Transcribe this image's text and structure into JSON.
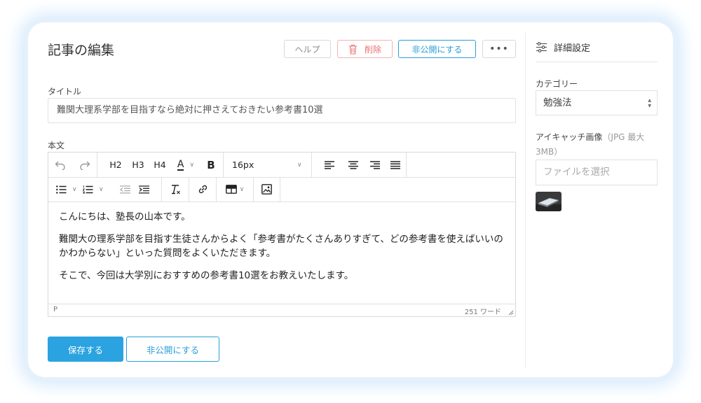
{
  "header": {
    "title": "記事の編集",
    "help_label": "ヘルプ",
    "delete_label": "削除",
    "unpublish_label": "非公開にする",
    "more_label": "•••"
  },
  "form": {
    "title_label": "タイトル",
    "title_value": "難関大理系学部を目指すなら絶対に押さえておきたい参考書10選",
    "body_label": "本文"
  },
  "toolbar": {
    "headings": [
      "H2",
      "H3",
      "H4"
    ],
    "text_color_label": "A",
    "bold_label": "B",
    "font_size": "16px"
  },
  "editor": {
    "paragraphs": [
      "こんにちは、塾長の山本です。",
      "難関大の理系学部を目指す生徒さんからよく「参考書がたくさんありすぎて、どの参考書を使えばいいのかわからない」といった質問をよくいただきます。",
      "そこで、今回は大学別におすすめの参考書10選をお教えいたします。"
    ],
    "status_path": "P",
    "word_count": "251 ワード"
  },
  "actions": {
    "save_label": "保存する",
    "unpublish_label": "非公開にする"
  },
  "sidebar": {
    "title": "詳細設定",
    "category_label": "カテゴリー",
    "category_value": "勉強法",
    "eyecatch_label": "アイキャッチ画像",
    "eyecatch_hint": "（JPG 最大3MB）",
    "file_placeholder": "ファイルを選択"
  },
  "colors": {
    "accent": "#2aa3e0",
    "danger": "#e87070",
    "glow": "#cfe6fb"
  }
}
